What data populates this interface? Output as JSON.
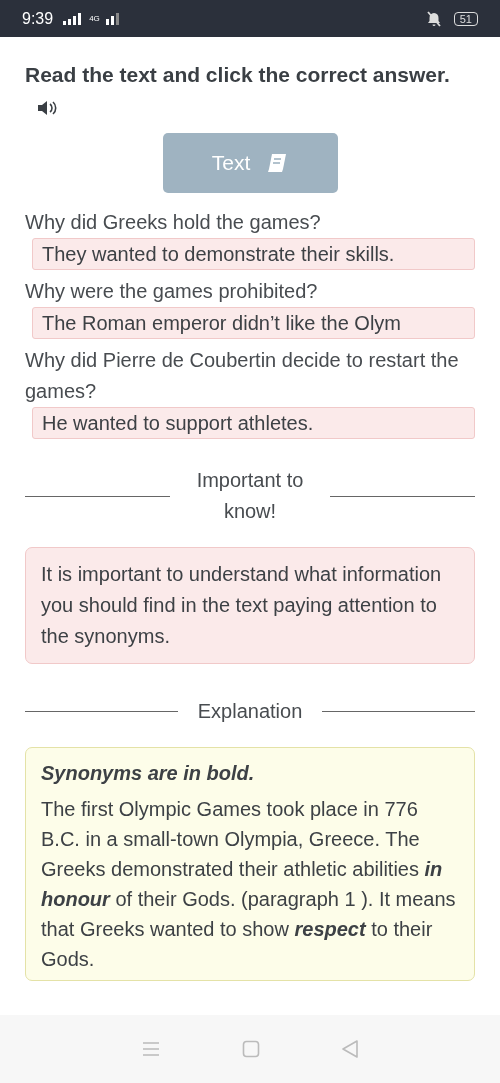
{
  "status_bar": {
    "time": "9:39",
    "network": "4G",
    "battery": "51"
  },
  "instruction": {
    "title": "Read the text and click the correct answer."
  },
  "text_button": {
    "label": "Text"
  },
  "questions": [
    {
      "question": "Why did Greeks hold the games?",
      "answer": "They wanted to demonstrate their skills."
    },
    {
      "question": "Why were the games prohibited?",
      "answer": "The Roman emperor didn’t like the Olym"
    },
    {
      "question": "Why did Pierre de Coubertin decide to restart the games?",
      "answer": "He wanted to support athletes."
    }
  ],
  "important": {
    "heading": "Important to know!",
    "note": "It is important to understand what information you should find in the text paying attention to the synonyms."
  },
  "explanation": {
    "heading": "Explanation",
    "title": "Synonyms are in bold.",
    "paragraph": "The first Olympic Games took place in 776 B.C. in a small-town Olympia, Greece. The Greeks demonstrated their athletic abilities **in honour** of their Gods. (paragraph 1 ). It means that Greeks wanted to show **respect** to their Gods."
  }
}
